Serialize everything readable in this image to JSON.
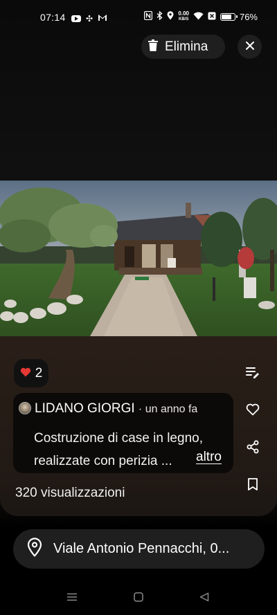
{
  "status_bar": {
    "time": "07:14",
    "speed_value": "0.00",
    "speed_unit": "KB/S",
    "battery_percent": "76%",
    "battery_level": 0.76,
    "icons": [
      "youtube-icon",
      "pinwheel-icon",
      "gmail-icon",
      "nfc-icon",
      "bluetooth-icon",
      "location-icon",
      "wifi-icon",
      "no-sim-icon",
      "battery-icon"
    ]
  },
  "toolbar": {
    "delete_label": "Elimina",
    "delete_icon": "trash-icon",
    "close_icon": "close-icon"
  },
  "post": {
    "likes": "2",
    "author": "LIDANO GIORGI",
    "time_ago": "· un anno fa",
    "description": "Costruzione di case in legno, realizzate con perizia ...",
    "more_label": "altro",
    "views": "320 visualizzazioni"
  },
  "side_actions": [
    "edit-description-icon",
    "heart-outline-icon",
    "share-icon",
    "bookmark-icon"
  ],
  "location": {
    "label": "Viale Antonio Pennacchi, 0..."
  },
  "navbar": [
    "menu-icon",
    "home-icon",
    "back-icon"
  ],
  "colors": {
    "like_heart": "#e53935",
    "pill_bg": "#1f1f1f",
    "panel_bg": "#2a1f18"
  }
}
